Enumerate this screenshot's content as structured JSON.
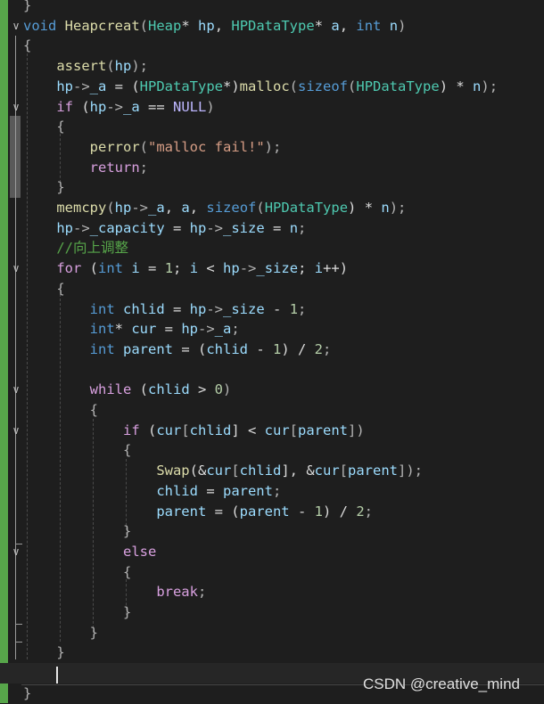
{
  "editor": {
    "code_lines": [
      [
        {
          "t": "}",
          "c": "pun"
        }
      ],
      [
        {
          "t": "void",
          "c": "kw"
        },
        {
          "t": " ",
          "c": "txt"
        },
        {
          "t": "Heapcreat",
          "c": "fn"
        },
        {
          "t": "(",
          "c": "pun"
        },
        {
          "t": "Heap",
          "c": "type"
        },
        {
          "t": "* ",
          "c": "txt"
        },
        {
          "t": "hp",
          "c": "var"
        },
        {
          "t": ", ",
          "c": "txt"
        },
        {
          "t": "HPDataType",
          "c": "type"
        },
        {
          "t": "* ",
          "c": "txt"
        },
        {
          "t": "a",
          "c": "var"
        },
        {
          "t": ", ",
          "c": "txt"
        },
        {
          "t": "int",
          "c": "kw"
        },
        {
          "t": " ",
          "c": "txt"
        },
        {
          "t": "n",
          "c": "var"
        },
        {
          "t": ")",
          "c": "pun"
        }
      ],
      [
        {
          "t": "{",
          "c": "pun"
        }
      ],
      [
        {
          "t": "    ",
          "c": "txt"
        },
        {
          "t": "assert",
          "c": "fn"
        },
        {
          "t": "(",
          "c": "pun"
        },
        {
          "t": "hp",
          "c": "var"
        },
        {
          "t": ");",
          "c": "pun"
        }
      ],
      [
        {
          "t": "    ",
          "c": "txt"
        },
        {
          "t": "hp",
          "c": "var"
        },
        {
          "t": "->",
          "c": "pun"
        },
        {
          "t": "_a",
          "c": "var"
        },
        {
          "t": " = (",
          "c": "txt"
        },
        {
          "t": "HPDataType",
          "c": "type"
        },
        {
          "t": "*)",
          "c": "txt"
        },
        {
          "t": "malloc",
          "c": "fn"
        },
        {
          "t": "(",
          "c": "pun"
        },
        {
          "t": "sizeof",
          "c": "kw"
        },
        {
          "t": "(",
          "c": "pun"
        },
        {
          "t": "HPDataType",
          "c": "type"
        },
        {
          "t": ") * ",
          "c": "txt"
        },
        {
          "t": "n",
          "c": "var"
        },
        {
          "t": ");",
          "c": "pun"
        }
      ],
      [
        {
          "t": "    ",
          "c": "txt"
        },
        {
          "t": "if",
          "c": "ctl"
        },
        {
          "t": " (",
          "c": "txt"
        },
        {
          "t": "hp",
          "c": "var"
        },
        {
          "t": "->",
          "c": "pun"
        },
        {
          "t": "_a",
          "c": "var"
        },
        {
          "t": " == ",
          "c": "txt"
        },
        {
          "t": "NULL",
          "c": "mac"
        },
        {
          "t": ")",
          "c": "pun"
        }
      ],
      [
        {
          "t": "    {",
          "c": "pun"
        }
      ],
      [
        {
          "t": "        ",
          "c": "txt"
        },
        {
          "t": "perror",
          "c": "fn"
        },
        {
          "t": "(",
          "c": "pun"
        },
        {
          "t": "\"malloc fail!\"",
          "c": "str"
        },
        {
          "t": ");",
          "c": "pun"
        }
      ],
      [
        {
          "t": "        ",
          "c": "txt"
        },
        {
          "t": "return",
          "c": "ctl"
        },
        {
          "t": ";",
          "c": "pun"
        }
      ],
      [
        {
          "t": "    }",
          "c": "pun"
        }
      ],
      [
        {
          "t": "    ",
          "c": "txt"
        },
        {
          "t": "memcpy",
          "c": "fn"
        },
        {
          "t": "(",
          "c": "pun"
        },
        {
          "t": "hp",
          "c": "var"
        },
        {
          "t": "->",
          "c": "pun"
        },
        {
          "t": "_a",
          "c": "var"
        },
        {
          "t": ", ",
          "c": "txt"
        },
        {
          "t": "a",
          "c": "var"
        },
        {
          "t": ", ",
          "c": "txt"
        },
        {
          "t": "sizeof",
          "c": "kw"
        },
        {
          "t": "(",
          "c": "pun"
        },
        {
          "t": "HPDataType",
          "c": "type"
        },
        {
          "t": ") * ",
          "c": "txt"
        },
        {
          "t": "n",
          "c": "var"
        },
        {
          "t": ");",
          "c": "pun"
        }
      ],
      [
        {
          "t": "    ",
          "c": "txt"
        },
        {
          "t": "hp",
          "c": "var"
        },
        {
          "t": "->",
          "c": "pun"
        },
        {
          "t": "_capacity",
          "c": "var"
        },
        {
          "t": " = ",
          "c": "txt"
        },
        {
          "t": "hp",
          "c": "var"
        },
        {
          "t": "->",
          "c": "pun"
        },
        {
          "t": "_size",
          "c": "var"
        },
        {
          "t": " = ",
          "c": "txt"
        },
        {
          "t": "n",
          "c": "var"
        },
        {
          "t": ";",
          "c": "pun"
        }
      ],
      [
        {
          "t": "    ",
          "c": "txt"
        },
        {
          "t": "//向上调整",
          "c": "cmt"
        }
      ],
      [
        {
          "t": "    ",
          "c": "txt"
        },
        {
          "t": "for",
          "c": "ctl"
        },
        {
          "t": " (",
          "c": "txt"
        },
        {
          "t": "int",
          "c": "kw"
        },
        {
          "t": " ",
          "c": "txt"
        },
        {
          "t": "i",
          "c": "var"
        },
        {
          "t": " = ",
          "c": "txt"
        },
        {
          "t": "1",
          "c": "num"
        },
        {
          "t": "; ",
          "c": "txt"
        },
        {
          "t": "i",
          "c": "var"
        },
        {
          "t": " < ",
          "c": "txt"
        },
        {
          "t": "hp",
          "c": "var"
        },
        {
          "t": "->",
          "c": "pun"
        },
        {
          "t": "_size",
          "c": "var"
        },
        {
          "t": "; ",
          "c": "txt"
        },
        {
          "t": "i",
          "c": "var"
        },
        {
          "t": "++)",
          "c": "txt"
        }
      ],
      [
        {
          "t": "    {",
          "c": "pun"
        }
      ],
      [
        {
          "t": "        ",
          "c": "txt"
        },
        {
          "t": "int",
          "c": "kw"
        },
        {
          "t": " ",
          "c": "txt"
        },
        {
          "t": "chlid",
          "c": "var"
        },
        {
          "t": " = ",
          "c": "txt"
        },
        {
          "t": "hp",
          "c": "var"
        },
        {
          "t": "->",
          "c": "pun"
        },
        {
          "t": "_size",
          "c": "var"
        },
        {
          "t": " - ",
          "c": "txt"
        },
        {
          "t": "1",
          "c": "num"
        },
        {
          "t": ";",
          "c": "pun"
        }
      ],
      [
        {
          "t": "        ",
          "c": "txt"
        },
        {
          "t": "int",
          "c": "kw"
        },
        {
          "t": "* ",
          "c": "txt"
        },
        {
          "t": "cur",
          "c": "var"
        },
        {
          "t": " = ",
          "c": "txt"
        },
        {
          "t": "hp",
          "c": "var"
        },
        {
          "t": "->",
          "c": "pun"
        },
        {
          "t": "_a",
          "c": "var"
        },
        {
          "t": ";",
          "c": "pun"
        }
      ],
      [
        {
          "t": "        ",
          "c": "txt"
        },
        {
          "t": "int",
          "c": "kw"
        },
        {
          "t": " ",
          "c": "txt"
        },
        {
          "t": "parent",
          "c": "var"
        },
        {
          "t": " = (",
          "c": "txt"
        },
        {
          "t": "chlid",
          "c": "var"
        },
        {
          "t": " - ",
          "c": "txt"
        },
        {
          "t": "1",
          "c": "num"
        },
        {
          "t": ") / ",
          "c": "txt"
        },
        {
          "t": "2",
          "c": "num"
        },
        {
          "t": ";",
          "c": "pun"
        }
      ],
      [],
      [
        {
          "t": "        ",
          "c": "txt"
        },
        {
          "t": "while",
          "c": "ctl"
        },
        {
          "t": " (",
          "c": "txt"
        },
        {
          "t": "chlid",
          "c": "var"
        },
        {
          "t": " > ",
          "c": "txt"
        },
        {
          "t": "0",
          "c": "num"
        },
        {
          "t": ")",
          "c": "pun"
        }
      ],
      [
        {
          "t": "        {",
          "c": "pun"
        }
      ],
      [
        {
          "t": "            ",
          "c": "txt"
        },
        {
          "t": "if",
          "c": "ctl"
        },
        {
          "t": " (",
          "c": "txt"
        },
        {
          "t": "cur",
          "c": "var"
        },
        {
          "t": "[",
          "c": "pun"
        },
        {
          "t": "chlid",
          "c": "var"
        },
        {
          "t": "] < ",
          "c": "txt"
        },
        {
          "t": "cur",
          "c": "var"
        },
        {
          "t": "[",
          "c": "pun"
        },
        {
          "t": "parent",
          "c": "var"
        },
        {
          "t": "])",
          "c": "pun"
        }
      ],
      [
        {
          "t": "            {",
          "c": "pun"
        }
      ],
      [
        {
          "t": "                ",
          "c": "txt"
        },
        {
          "t": "Swap",
          "c": "fn"
        },
        {
          "t": "(&",
          "c": "txt"
        },
        {
          "t": "cur",
          "c": "var"
        },
        {
          "t": "[",
          "c": "pun"
        },
        {
          "t": "chlid",
          "c": "var"
        },
        {
          "t": "], &",
          "c": "txt"
        },
        {
          "t": "cur",
          "c": "var"
        },
        {
          "t": "[",
          "c": "pun"
        },
        {
          "t": "parent",
          "c": "var"
        },
        {
          "t": "]);",
          "c": "pun"
        }
      ],
      [
        {
          "t": "                ",
          "c": "txt"
        },
        {
          "t": "chlid",
          "c": "var"
        },
        {
          "t": " = ",
          "c": "txt"
        },
        {
          "t": "parent",
          "c": "var"
        },
        {
          "t": ";",
          "c": "pun"
        }
      ],
      [
        {
          "t": "                ",
          "c": "txt"
        },
        {
          "t": "parent",
          "c": "var"
        },
        {
          "t": " = (",
          "c": "txt"
        },
        {
          "t": "parent",
          "c": "var"
        },
        {
          "t": " - ",
          "c": "txt"
        },
        {
          "t": "1",
          "c": "num"
        },
        {
          "t": ") / ",
          "c": "txt"
        },
        {
          "t": "2",
          "c": "num"
        },
        {
          "t": ";",
          "c": "pun"
        }
      ],
      [
        {
          "t": "            }",
          "c": "pun"
        }
      ],
      [
        {
          "t": "            ",
          "c": "txt"
        },
        {
          "t": "else",
          "c": "ctl"
        }
      ],
      [
        {
          "t": "            {",
          "c": "pun"
        }
      ],
      [
        {
          "t": "                ",
          "c": "txt"
        },
        {
          "t": "break",
          "c": "ctl"
        },
        {
          "t": ";",
          "c": "pun"
        }
      ],
      [
        {
          "t": "            }",
          "c": "pun"
        }
      ],
      [
        {
          "t": "        }",
          "c": "pun"
        }
      ],
      [
        {
          "t": "    }",
          "c": "pun"
        }
      ],
      [],
      [
        {
          "t": "}",
          "c": "pun"
        }
      ]
    ],
    "fold_lines": [
      1,
      5,
      13,
      19,
      21,
      27
    ],
    "current_line": 33,
    "colors": {
      "background": "#1e1e1e",
      "keyword": "#569cd6",
      "control": "#d8a0df",
      "type": "#4ec9b0",
      "function": "#dcdcaa",
      "variable": "#9cdcfe",
      "macro": "#beb7ff",
      "string": "#d69d85",
      "number": "#b5cea8",
      "comment": "#57a64a",
      "changed_bar": "#57a64a"
    },
    "fold_icon": "chevron-down-icon"
  },
  "watermark": {
    "text": "CSDN @creative_mind"
  }
}
